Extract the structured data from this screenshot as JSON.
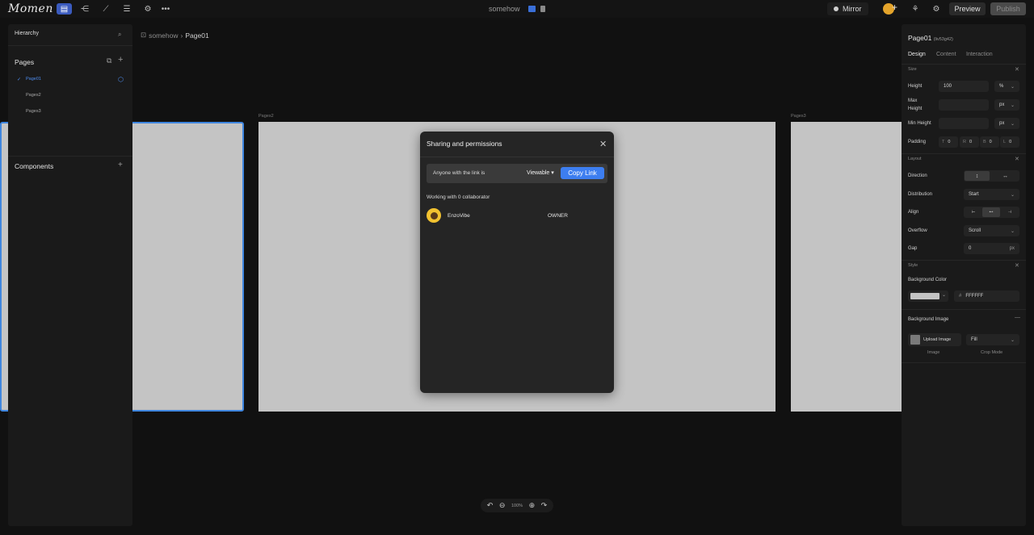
{
  "topbar": {
    "logo": "Momen",
    "project_title": "somehow",
    "mirror_label": "Mirror",
    "preview_label": "Preview",
    "publish_label": "Publish"
  },
  "left_panel": {
    "hierarchy_label": "Hierarchy",
    "pages_label": "Pages",
    "pages": [
      "Page01",
      "Pages2",
      "Pages3"
    ],
    "components_label": "Components"
  },
  "breadcrumb": {
    "project": "somehow",
    "separator": "›",
    "page": "Page01"
  },
  "canvas": {
    "frame_labels": [
      "Pages2",
      "Pages3"
    ],
    "zoom_value": "100%",
    "frame_color": "#c4c4c4",
    "selection_color": "#3f86df"
  },
  "modal": {
    "title": "Sharing and permissions",
    "link_text": "Anyone with the link is",
    "permission": "Viewable",
    "copy_label": "Copy Link",
    "collaborator_text": "Working with 0 collaborator",
    "user_name": "EnzoVibe",
    "user_role": "OWNER",
    "accent": "#3d7ef0"
  },
  "right_panel": {
    "page_name": "Page01",
    "page_id": "(liv53g42)",
    "tabs": [
      "Design",
      "Content",
      "Interaction"
    ],
    "size": {
      "title": "Size",
      "height_label": "Height",
      "height_value": "100",
      "height_unit": "%",
      "max_height_label_1": "Max",
      "max_height_label_2": "Height",
      "max_height_unit": "px",
      "min_height_label": "Min Height",
      "min_height_unit": "px",
      "padding_label": "Padding",
      "padding": [
        {
          "k": "T",
          "v": "0"
        },
        {
          "k": "R",
          "v": "0"
        },
        {
          "k": "B",
          "v": "0"
        },
        {
          "k": "L",
          "v": "0"
        }
      ]
    },
    "layout": {
      "title": "Layout",
      "direction_label": "Direction",
      "distribution_label": "Distribution",
      "distribution_value": "Start",
      "align_label": "Align",
      "overflow_label": "Overflow",
      "overflow_value": "Scroll",
      "gap_label": "Gap",
      "gap_value": "0",
      "gap_unit": "px"
    },
    "style": {
      "title": "Style",
      "bg_color_label": "Background Color",
      "bg_color_hex": "FFFFFF",
      "bg_image_label": "Background Image",
      "upload_label": "Upload Image",
      "crop_value": "Fill",
      "image_caption": "Image",
      "crop_caption": "Crop Mode"
    }
  }
}
